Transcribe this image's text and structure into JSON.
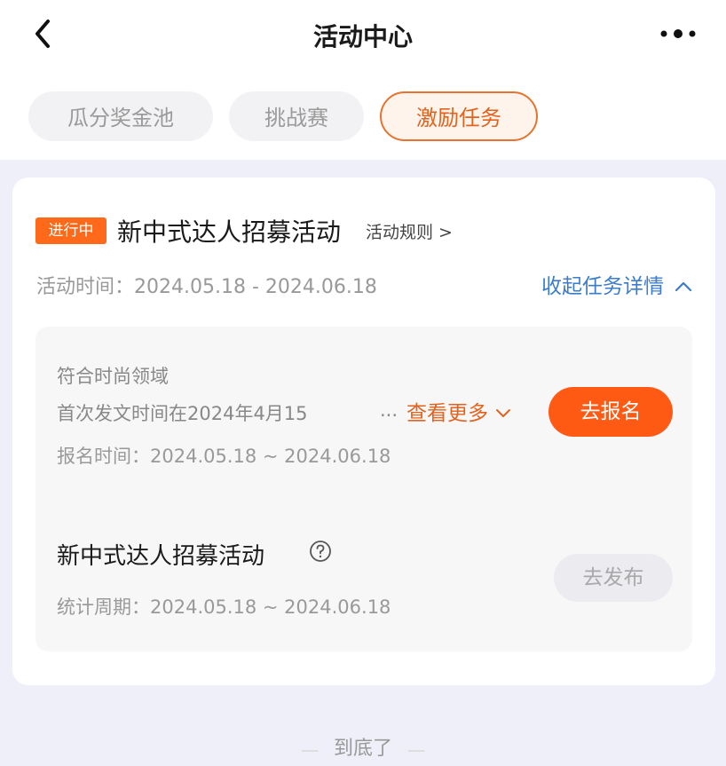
{
  "header": {
    "title": "活动中心"
  },
  "tabs": [
    {
      "label": "瓜分奖金池",
      "active": false
    },
    {
      "label": "挑战赛",
      "active": false
    },
    {
      "label": "激励任务",
      "active": true
    }
  ],
  "activity": {
    "status_badge": "进行中",
    "title": "新中式达人招募活动",
    "rules_link": "活动规则 >",
    "time_text": "活动时间：2024.05.18 - 2024.06.18",
    "collapse_label": "收起任务详情",
    "task": {
      "requirement_1": "符合时尚领域",
      "requirement_2": "首次发文时间在2024年4月15",
      "ellipsis": "...",
      "see_more_label": "查看更多",
      "signup_time": "报名时间：2024.05.18 ~ 2024.06.18",
      "signup_button": "去报名"
    },
    "sub_task": {
      "title": "新中式达人招募活动",
      "stat_period": "统计周期：2024.05.18 ~ 2024.06.18",
      "publish_button": "去发布"
    }
  },
  "footer": {
    "text": "到底了"
  },
  "colors": {
    "accent": "#ff5a14",
    "link": "#3b7dcc",
    "background": "#eeeff8"
  }
}
